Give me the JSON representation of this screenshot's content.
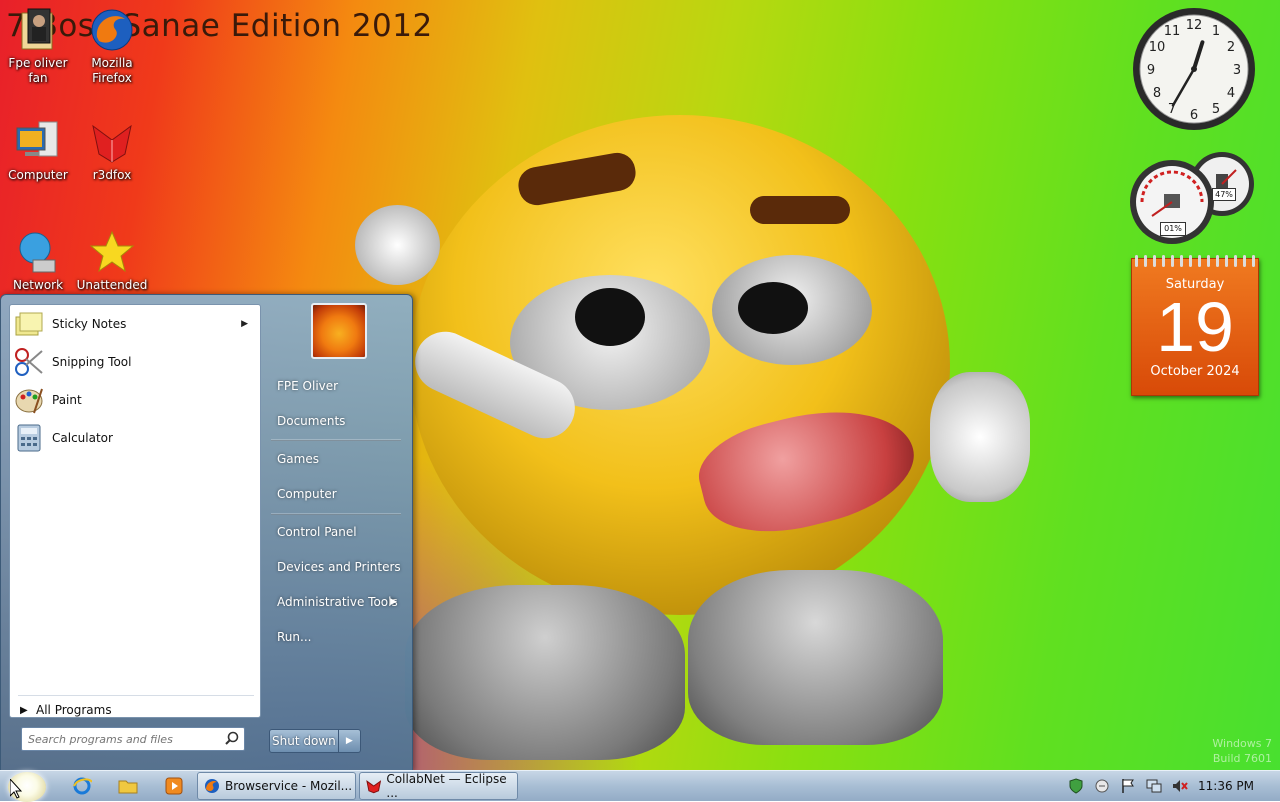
{
  "wallpaper": {
    "title": "7 Boss Sanae Edition 2012",
    "watermark_line1": "Windows 7",
    "watermark_line2": "Build 7601"
  },
  "desktop_icons": [
    {
      "label": "Fpe oliver fan",
      "icon": "user-folder-icon"
    },
    {
      "label": "Mozilla Firefox",
      "icon": "firefox-icon"
    },
    {
      "label": "Computer",
      "icon": "computer-icon"
    },
    {
      "label": "r3dfox",
      "icon": "r3dfox-icon"
    },
    {
      "label": "Network",
      "icon": "network-icon"
    },
    {
      "label": "Unattended",
      "icon": "star-icon"
    }
  ],
  "gadgets": {
    "clock": {
      "hour": 12,
      "minute": 35
    },
    "meter": {
      "cpu": "01%",
      "memory": "47%"
    },
    "calendar": {
      "weekday": "Saturday",
      "day": "19",
      "month_year": "October 2024"
    }
  },
  "start_menu": {
    "programs": [
      {
        "label": "Sticky Notes",
        "icon": "sticky-notes-icon",
        "has_submenu": true
      },
      {
        "label": "Snipping Tool",
        "icon": "scissors-icon",
        "has_submenu": false
      },
      {
        "label": "Paint",
        "icon": "paint-palette-icon",
        "has_submenu": false
      },
      {
        "label": "Calculator",
        "icon": "calculator-icon",
        "has_submenu": false
      }
    ],
    "all_programs_label": "All Programs",
    "search_placeholder": "Search programs and files",
    "right_items": [
      {
        "label": "FPE Oliver"
      },
      {
        "label": "Documents"
      },
      {
        "label": "Games"
      },
      {
        "label": "Computer"
      },
      {
        "label": "Control Panel"
      },
      {
        "label": "Devices and Printers"
      },
      {
        "label": "Administrative Tools"
      },
      {
        "label": "Run..."
      }
    ],
    "shutdown_label": "Shut down"
  },
  "taskbar": {
    "tasks": [
      {
        "label": "Browservice - Mozil...",
        "icon": "firefox-icon"
      },
      {
        "label": "CollabNet — Eclipse ...",
        "icon": "eclipse-icon"
      }
    ],
    "time": "11:36 PM"
  }
}
